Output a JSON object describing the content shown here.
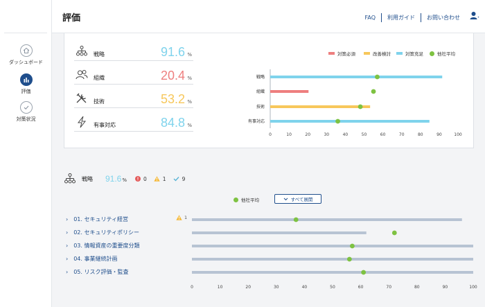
{
  "sidebar": {
    "items": [
      {
        "label": "ダッシュボード",
        "icon": "home-icon"
      },
      {
        "label": "評価",
        "icon": "chart-icon",
        "active": true
      },
      {
        "label": "対策状況",
        "icon": "check-icon"
      }
    ]
  },
  "header": {
    "title": "評価",
    "links": [
      "FAQ",
      "利用ガイド",
      "お問い合わせ"
    ]
  },
  "metrics": [
    {
      "label": "戦略",
      "value": "91.6",
      "unit": "%",
      "color": "#7fd3ec",
      "icon": "org-chart-icon"
    },
    {
      "label": "組織",
      "value": "20.4",
      "unit": "%",
      "color": "#ee7f7f",
      "icon": "people-icon"
    },
    {
      "label": "技術",
      "value": "53.2",
      "unit": "%",
      "color": "#f7c75b",
      "icon": "tools-icon"
    },
    {
      "label": "有事対応",
      "value": "84.8",
      "unit": "%",
      "color": "#7fd3ec",
      "icon": "lightning-icon"
    }
  ],
  "colors": {
    "danger": "#ee7f7f",
    "warn": "#f7c75b",
    "ok": "#7fd3ec",
    "avg": "#7ec242",
    "track": "#b7c3d3",
    "link": "#1f4e8c"
  },
  "chart_data": [
    {
      "type": "bar",
      "orientation": "horizontal",
      "categories": [
        "戦略",
        "組織",
        "技術",
        "有事対応"
      ],
      "legend": [
        "対策必須",
        "改善検討",
        "対策充足",
        "他社平均"
      ],
      "legend_position": "top-right",
      "series": [
        {
          "name": "対策必須",
          "color": "#ee7f7f",
          "values": [
            null,
            20.4,
            null,
            null
          ]
        },
        {
          "name": "改善検討",
          "color": "#f7c75b",
          "values": [
            null,
            null,
            53.2,
            null
          ]
        },
        {
          "name": "対策充足",
          "color": "#7fd3ec",
          "values": [
            91.6,
            null,
            null,
            84.8
          ]
        }
      ],
      "points": {
        "name": "他社平均",
        "values": [
          57,
          55,
          48,
          36
        ]
      },
      "xlim": [
        0,
        100
      ],
      "xticks": [
        0,
        10,
        20,
        30,
        40,
        50,
        60,
        70,
        80,
        90,
        100
      ]
    },
    {
      "type": "bar",
      "orientation": "horizontal",
      "categories": [
        "01. セキュリティ経営",
        "02. セキュリティポリシー",
        "03. 情報資産の重要度分類",
        "04. 事業継続計画",
        "05. リスク評価・監査"
      ],
      "series": [
        {
          "name": "",
          "values": [
            96,
            62,
            100,
            100,
            100
          ]
        }
      ],
      "points": {
        "name": "他社平均",
        "values": [
          37,
          72,
          57,
          56,
          61
        ]
      },
      "xlim": [
        0,
        100
      ],
      "xticks": [
        0,
        10,
        20,
        30,
        40,
        50,
        60,
        70,
        80,
        90,
        100
      ]
    }
  ],
  "section": {
    "label": "戦略",
    "value": "91.6",
    "unit": "%",
    "stats": [
      {
        "icon": "error-icon",
        "count": "0"
      },
      {
        "icon": "warning-icon",
        "count": "1"
      },
      {
        "icon": "check-icon",
        "count": "9"
      }
    ],
    "avg_label": "他社平均",
    "expand_label": "すべて展開",
    "warn_count": "1"
  }
}
